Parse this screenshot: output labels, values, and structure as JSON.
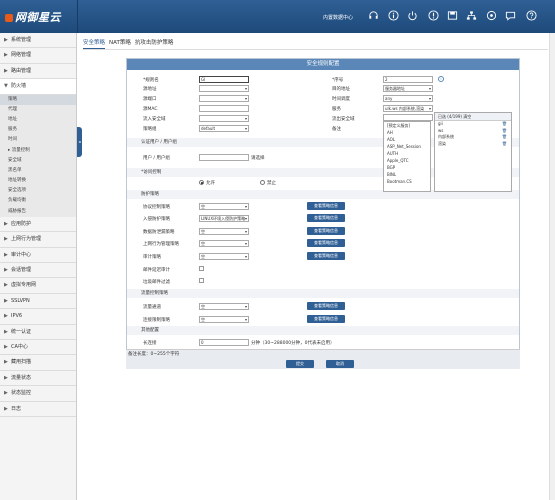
{
  "app": {
    "brand": "网御星云",
    "user": "内置数据中心"
  },
  "topbar_icons": [
    "headset-icon",
    "info-icon",
    "power-icon",
    "warning-icon",
    "save-icon",
    "network-icon",
    "settings-icon",
    "chat-icon",
    "help-icon"
  ],
  "sidebar": {
    "items": [
      {
        "label": "系统管理"
      },
      {
        "label": "网络管理"
      },
      {
        "label": "路由管理"
      },
      {
        "label": "防火墙",
        "open": true
      }
    ],
    "sub": [
      "策略",
      "代理",
      "地址",
      "服务",
      "时间",
      "流量控制",
      "安全域",
      "黑名单",
      "地址转换",
      "安全选项",
      "负载均衡",
      "威胁报告"
    ],
    "active_sub": "策略",
    "rest": [
      "应用防护",
      "上网行为管理",
      "审计中心",
      "会话管理",
      "虚拟专用网",
      "SSLVPN",
      "IPV6",
      "统一认证",
      "CA中心",
      "藏用扫描",
      "流量状态",
      "状态监控",
      "日志"
    ]
  },
  "tabs": [
    "安全策略",
    "NAT策略",
    "抗攻击防护策略"
  ],
  "panel": {
    "title": "安全规则配置",
    "fields": {
      "rule_name_label": "*规则名",
      "rule_name_value": "GI",
      "src_addr_label": "源地址",
      "src_port_label": "源端口",
      "src_mac_label": "源MAC",
      "inflow_zone_label": "流入安全域",
      "policy_group_label": "策略组",
      "policy_group_value": "default",
      "seq_label": "*序号",
      "seq_value": "2",
      "dst_addr_label": "目的地址",
      "dst_addr_value": "服务器地址",
      "time_label": "时间调度",
      "time_value": "any",
      "service_label": "服务",
      "service_value": "ulk.ws 内部系统,渲染",
      "outflow_zone_label": "流出安全域",
      "remark_label": "备注"
    },
    "service_list": [
      "[预定义服务]",
      "AH",
      "AOL",
      "ASP_Net_Session",
      "AUTH",
      "Apple_QTC",
      "BGP",
      "BINL",
      "Bootman.CS"
    ],
    "selected_box": {
      "header": "已选 (4/199)   清空",
      "items": [
        "gii",
        "ws",
        "内部系统",
        "渲染"
      ]
    },
    "auth": {
      "label": "认证用户 / 用户组",
      "user_label": "用户 / 用户组",
      "select_link": "请选择"
    },
    "access": {
      "label": "*访问控制",
      "allow": "允许",
      "deny": "禁止"
    },
    "protect": {
      "label": "防护策略",
      "rows": [
        {
          "label": "协议控制策略",
          "value": "空",
          "btn": "查看策略信息"
        },
        {
          "label": "入侵防护策略",
          "value": "LINUX环境入侵防护策略",
          "btn": "查看策略信息"
        },
        {
          "label": "数据防泄漏策略",
          "value": "空",
          "btn": "查看策略信息"
        },
        {
          "label": "上网行为管理策略",
          "value": "空",
          "btn": "查看策略信息"
        },
        {
          "label": "审计策略",
          "value": "空",
          "btn": "查看策略信息"
        }
      ],
      "mail_audit": "邮件延迟审计",
      "junk_filter": "垃圾邮件过滤"
    },
    "flow": {
      "label": "流量控制策略",
      "rows": [
        {
          "label": "流量通道",
          "value": "空",
          "btn": "查看策略信息"
        },
        {
          "label": "连接限制策略",
          "value": "空",
          "btn": "查看策略信息"
        }
      ]
    },
    "other": {
      "label": "其他配置",
      "long_conn_label": "长连接",
      "long_conn_value": "0",
      "long_conn_hint": "分钟（30~288000分钟，0代表未启用）"
    },
    "remark_hint": "备注长度：0~255个字符",
    "ok": "提交",
    "cancel": "取消"
  }
}
